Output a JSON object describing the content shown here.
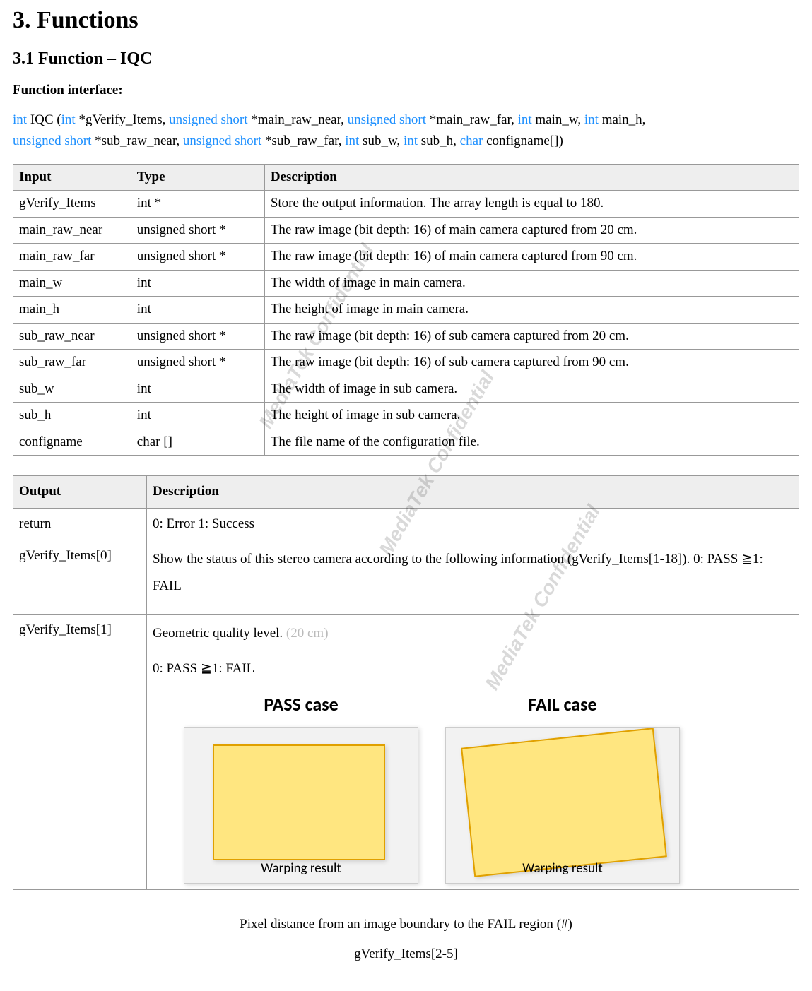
{
  "headings": {
    "h1": "3. Functions",
    "h2": "3.1 Function – IQC",
    "fi": "Function interface:"
  },
  "sig": {
    "p1_kw1": "int",
    "p1_t1": " IQC (",
    "p1_kw2": "int",
    "p1_t2": " *gVerify_Items, ",
    "p1_kw3": "unsigned short",
    "p1_t3": " *main_raw_near, ",
    "p1_kw4": "unsigned short",
    "p1_t4": " *main_raw_far, ",
    "p1_kw5": "int",
    "p1_t5": " main_w, ",
    "p1_kw6": "int",
    "p1_t6": " main_h, ",
    "p2_kw1": "unsigned short",
    "p2_t1": " *sub_raw_near, ",
    "p2_kw2": "unsigned short",
    "p2_t2": " *sub_raw_far, ",
    "p2_kw3": "int",
    "p2_t3": " sub_w, ",
    "p2_kw4": "int",
    "p2_t4": " sub_h, ",
    "p2_kw5": "char",
    "p2_t5": " configname[])"
  },
  "t1": {
    "h1": "Input",
    "h2": "Type",
    "h3": "Description",
    "rows": [
      {
        "a": "gVerify_Items",
        "b": "int *",
        "c": "Store the output information. The array length is equal to 180."
      },
      {
        "a": "main_raw_near",
        "b": "unsigned short *",
        "c": "The raw image (bit depth: 16) of main camera captured from 20 cm."
      },
      {
        "a": "main_raw_far",
        "b": "unsigned short *",
        "c": "The raw image (bit depth: 16) of main camera captured from 90 cm."
      },
      {
        "a": "main_w",
        "b": "int",
        "c": "The width of image in main camera."
      },
      {
        "a": "main_h",
        "b": "int",
        "c": "The height of image in main camera."
      },
      {
        "a": "sub_raw_near",
        "b": "unsigned short *",
        "c": "The raw image (bit depth: 16) of sub camera captured from 20 cm."
      },
      {
        "a": "sub_raw_far",
        "b": "unsigned short *",
        "c": "The raw image (bit depth: 16) of sub camera captured from 90 cm."
      },
      {
        "a": "sub_w",
        "b": "int",
        "c": "The width of image in sub camera."
      },
      {
        "a": "sub_h",
        "b": "int",
        "c": "The height of image in sub camera."
      },
      {
        "a": "configname",
        "b": "char  []",
        "c": "The file name of the configuration file."
      }
    ]
  },
  "t2": {
    "h1": "Output",
    "h2": "Description",
    "r0a": "return",
    "r0b": "0: Error  1: Success",
    "r1a": "gVerify_Items[0]",
    "r1b": "Show the status of this stereo camera according to the following information (gVerify_Items[1-18]). 0: PASS  ≧1: FAIL",
    "r2a": "gVerify_Items[1]",
    "r2b_line1a": "Geometric quality level. ",
    "r2b_line1b": "(20 cm)",
    "r2b_line2": "0: PASS  ≧1: FAIL",
    "pass_title": "PASS case",
    "fail_title": "FAIL case",
    "warp": "Warping result"
  },
  "after": {
    "l1": "Pixel distance from an image boundary to the FAIL region (#)",
    "l2": "gVerify_Items[2-5]"
  },
  "wm": "MediaTek Confidential"
}
